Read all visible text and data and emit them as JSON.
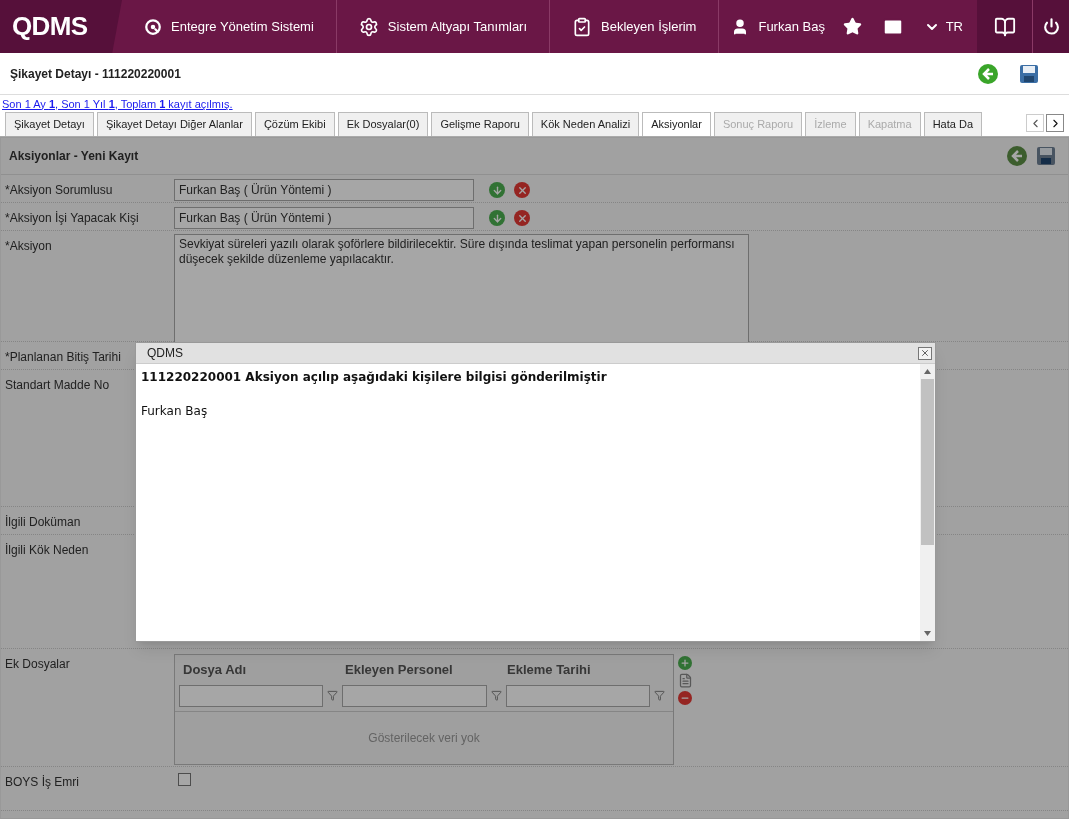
{
  "topbar": {
    "logo": "QDMS",
    "nav": [
      {
        "kind": "system",
        "label": "Entegre Yönetim Sistemi"
      },
      {
        "kind": "settings",
        "label": "Sistem Altyapı Tanımları"
      },
      {
        "kind": "tasks",
        "label": "Bekleyen İşlerim"
      }
    ],
    "user": "Furkan Baş",
    "language": "TR"
  },
  "page": {
    "title": "Şikayet Detayı - 111220220001"
  },
  "visit_summary": "Son 1 Ay **1**, Son 1 Yıl **1**, Toplam **1** kayıt açılmış.",
  "tabs": [
    {
      "label": "Şikayet Detayı",
      "selected": false,
      "disabled": false
    },
    {
      "label": "Şikayet Detayı Diğer Alanlar",
      "selected": false,
      "disabled": false
    },
    {
      "label": "Çözüm Ekibi",
      "selected": false,
      "disabled": false
    },
    {
      "label": "Ek Dosyalar(0)",
      "selected": false,
      "disabled": false
    },
    {
      "label": "Gelişme Raporu",
      "selected": false,
      "disabled": false
    },
    {
      "label": "Kök Neden Analizi",
      "selected": false,
      "disabled": false
    },
    {
      "label": "Aksiyonlar",
      "selected": true,
      "disabled": false
    },
    {
      "label": "Sonuç Raporu",
      "selected": false,
      "disabled": true
    },
    {
      "label": "İzleme",
      "selected": false,
      "disabled": true
    },
    {
      "label": "Kapatma",
      "selected": false,
      "disabled": true
    },
    {
      "label": "Hata Da",
      "selected": false,
      "disabled": false
    }
  ],
  "form": {
    "title": "Aksiyonlar - Yeni Kayıt",
    "rows": [
      {
        "kind": "picker",
        "label": "*Aksiyon Sorumlusu",
        "value": "Furkan Baş ( Ürün Yöntemi )"
      },
      {
        "kind": "picker",
        "label": "*Aksiyon İşi Yapacak Kişi",
        "value": "Furkan Baş ( Ürün Yöntemi )"
      },
      {
        "kind": "textarea",
        "label": "*Aksiyon",
        "value": "Sevkiyat süreleri yazılı olarak şoförlere bildirilecektir. Süre dışında teslimat yapan personelin performansı düşecek şekilde düzenleme yapılacaktır."
      },
      {
        "kind": "covered_short",
        "label": "*Planlanan Bitiş Tarihi"
      },
      {
        "kind": "covered_tall",
        "label": "Standart Madde No"
      },
      {
        "kind": "covered_short",
        "label": "İlgili Doküman"
      },
      {
        "kind": "covered_medium",
        "label": "İlgili Kök Neden"
      },
      {
        "kind": "files",
        "label": "Ek Dosyalar",
        "columns": [
          "Dosya Adı",
          "Ekleyen Personel",
          "Ekleme Tarihi"
        ],
        "empty_text": "Gösterilecek veri yok"
      },
      {
        "kind": "checkbox",
        "label": "BOYS İş Emri",
        "checked": false
      }
    ]
  },
  "dialog": {
    "title": "QDMS",
    "message": "111220220001 Aksiyon açılıp aşağıdaki kişilere bilgisi gönderilmiştir",
    "recipients": [
      "Furkan Baş"
    ]
  }
}
